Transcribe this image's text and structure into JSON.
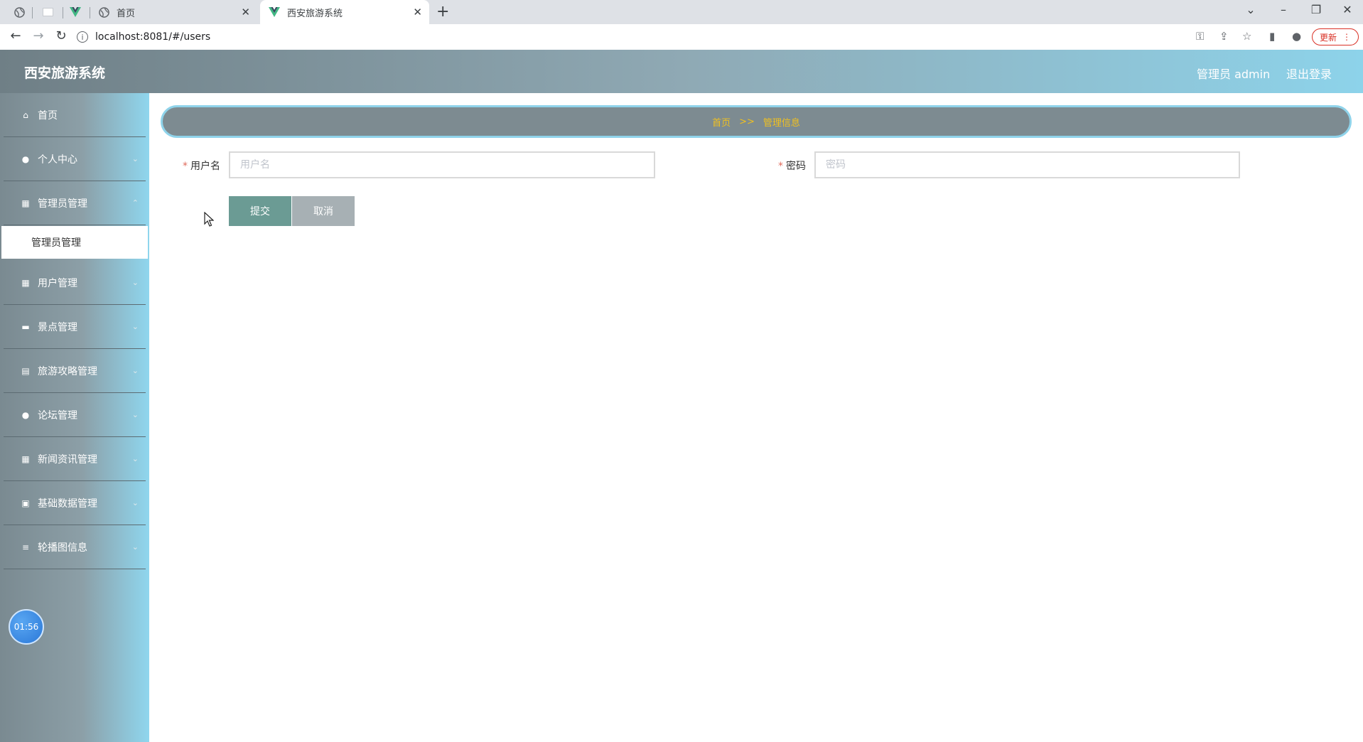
{
  "browser": {
    "tabs": [
      {
        "title": "",
        "icon": "globe-icon"
      },
      {
        "title": "",
        "icon": "blank-page-icon"
      },
      {
        "title": "",
        "icon": "vue-logo-icon"
      },
      {
        "title": "首页",
        "icon": "globe-icon"
      },
      {
        "title": "西安旅游系统",
        "icon": "vue-logo-icon",
        "active": true
      }
    ],
    "url": "localhost:8081/#/users",
    "update_label": "更新"
  },
  "header": {
    "title": "西安旅游系统",
    "user_label": "管理员 admin",
    "logout_label": "退出登录"
  },
  "sidebar": {
    "items": [
      {
        "label": "首页",
        "icon": "home-icon"
      },
      {
        "label": "个人中心",
        "icon": "user-icon"
      },
      {
        "label": "管理员管理",
        "icon": "grid-icon"
      },
      {
        "label": "用户管理",
        "icon": "grid-icon"
      },
      {
        "label": "景点管理",
        "icon": "chat-icon"
      },
      {
        "label": "旅游攻略管理",
        "icon": "clipboard-icon"
      },
      {
        "label": "论坛管理",
        "icon": "user-icon"
      },
      {
        "label": "新闻资讯管理",
        "icon": "grid-icon"
      },
      {
        "label": "基础数据管理",
        "icon": "briefcase-icon"
      },
      {
        "label": "轮播图信息",
        "icon": "list-icon"
      }
    ],
    "active_submenu": "管理员管理",
    "clock": "01:56"
  },
  "breadcrumb": {
    "home": "首页",
    "separator": ">>",
    "current": "管理信息"
  },
  "form": {
    "username": {
      "label": "用户名",
      "placeholder": "用户名",
      "value": ""
    },
    "password": {
      "label": "密码",
      "placeholder": "密码",
      "value": ""
    },
    "submit_label": "提交",
    "cancel_label": "取消"
  },
  "colors": {
    "header_start": "#6f7f86",
    "header_end": "#8dd3ea",
    "breadcrumb_bg": "#7d8b91",
    "breadcrumb_text": "#f0c020",
    "submit_bg": "#6b9b94",
    "cancel_bg": "#a7b0b4"
  }
}
